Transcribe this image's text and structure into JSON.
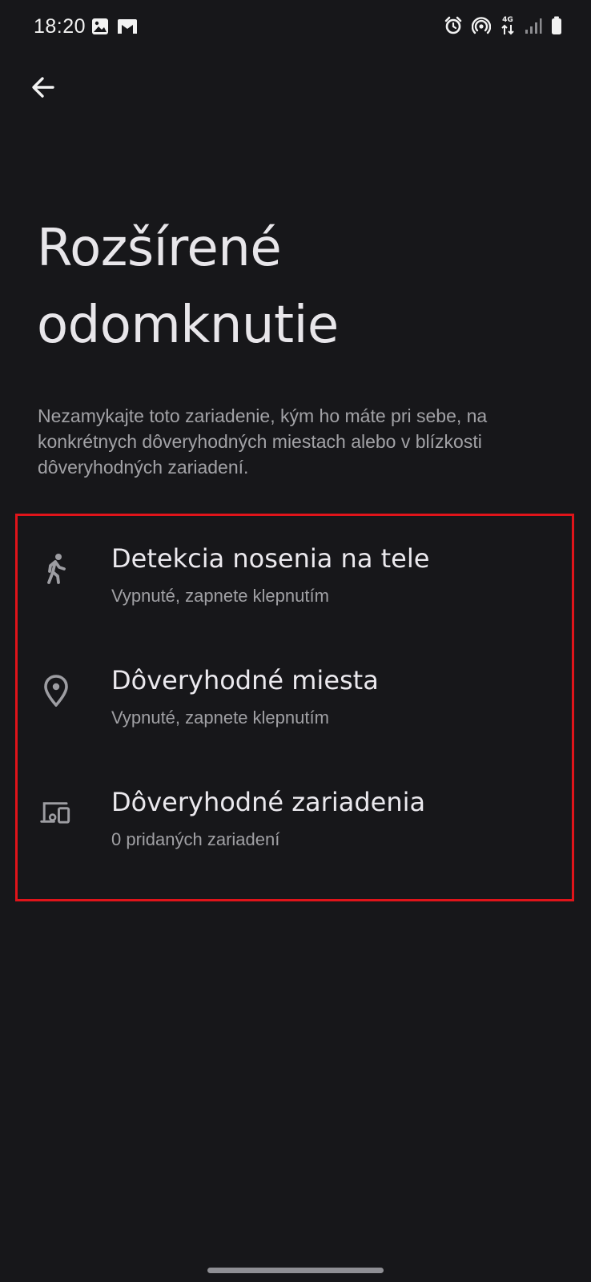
{
  "status_bar": {
    "time": "18:20",
    "left_icons": [
      "gallery-icon",
      "gmail-icon"
    ],
    "right_icons": [
      "alarm-icon",
      "hotspot-icon",
      "network-4g-icon",
      "signal-icon",
      "battery-icon"
    ],
    "network_type": "4G"
  },
  "header": {
    "back_icon": "arrow-back-icon"
  },
  "page": {
    "title": "Rozšírené odomknutie",
    "description": "Nezamykajte toto zariadenie, kým ho máte pri sebe, na konkrétnych dôveryhodných miestach alebo v blízkosti dôveryhodných zariadení."
  },
  "options": [
    {
      "icon": "walking-person-icon",
      "title": "Detekcia nosenia na tele",
      "subtitle": "Vypnuté, zapnete klepnutím"
    },
    {
      "icon": "location-pin-icon",
      "title": "Dôveryhodné miesta",
      "subtitle": "Vypnuté, zapnete klepnutím"
    },
    {
      "icon": "devices-icon",
      "title": "Dôveryhodné zariadenia",
      "subtitle": "0 pridaných zariadení"
    }
  ],
  "colors": {
    "background": "#17171a",
    "highlight_border": "#e0141a",
    "title_text": "#e8e6ea",
    "secondary_text": "#a0a0a4",
    "icon": "#9d9da2"
  }
}
